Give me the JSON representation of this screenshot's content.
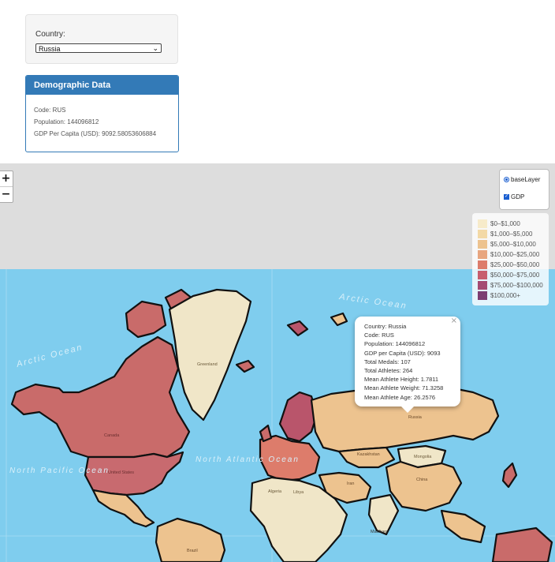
{
  "selector": {
    "label": "Country:",
    "selected": "Russia"
  },
  "demographic": {
    "title": "Demographic Data",
    "code": "Code: RUS",
    "population": "Population: 144096812",
    "gdp": "GDP Per Capita (USD): 9092.58053606884"
  },
  "zoom": {
    "in": "+",
    "out": "−"
  },
  "layers": {
    "base": "baseLayer",
    "overlay": "GDP"
  },
  "legend": [
    {
      "label": "$0–$1,000",
      "color": "#f7ebca"
    },
    {
      "label": "$1,000–$5,000",
      "color": "#f3d9a6"
    },
    {
      "label": "$5,000–$10,000",
      "color": "#edc38f"
    },
    {
      "label": "$10,000–$25,000",
      "color": "#e8a67f"
    },
    {
      "label": "$25,000–$50,000",
      "color": "#dd7c6b"
    },
    {
      "label": "$50,000–$75,000",
      "color": "#c75f6e"
    },
    {
      "label": "$75,000–$100,000",
      "color": "#a44b73"
    },
    {
      "label": "$100,000+",
      "color": "#7c3e72"
    }
  ],
  "popup": {
    "close": "×",
    "lines": [
      "Country: Russia",
      "Code: RUS",
      "Population: 144096812",
      "GDP per Capita (USD): 9093",
      "Total Medals: 107",
      "Total Athletes: 264",
      "Mean Athlete Height: 1.7811",
      "Mean Athlete Weight: 71.3258",
      "Mean Athlete Age: 26.2576"
    ]
  },
  "map_labels": {
    "arctic_ocean_right": "Arctic Ocean",
    "arctic_ocean_left": "Arctic Ocean",
    "north_atlantic": "North Atlantic Ocean",
    "north_pacific": "North Pacific Ocean",
    "greenland": "Greenland",
    "canada": "Canada",
    "united_states": "United States",
    "russia": "Russia",
    "kazakhstan": "Kazakhstan",
    "mongolia": "Mongolia",
    "china": "China",
    "algeria": "Algeria",
    "libya": "Libya",
    "iran": "Iran",
    "maldives": "Maldives",
    "brazil": "Brazil"
  },
  "colors": {
    "ocean": "#7fcdee",
    "land_base": "#f0e6c8",
    "border": "#111111"
  }
}
